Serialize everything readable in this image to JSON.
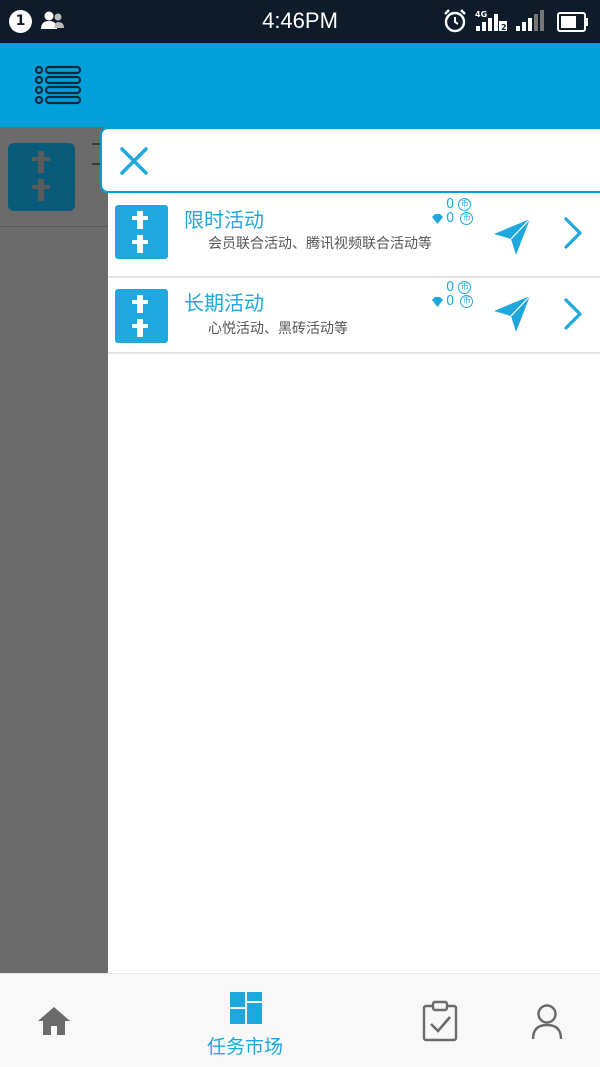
{
  "status_bar": {
    "notification_count": "1",
    "time": "4:46PM",
    "network": "4G",
    "sim": "2"
  },
  "drawer": {
    "items": [
      {
        "title": "限时活动",
        "description": "会员联合活动、腾讯视频联合活动等",
        "reward_top": "0",
        "reward_bottom": "0",
        "coin_glyph": "币"
      },
      {
        "title": "长期活动",
        "description": "心悦活动、黑砖活动等",
        "reward_top": "0",
        "reward_bottom": "0",
        "coin_glyph": "币"
      }
    ]
  },
  "bottom_nav": {
    "items": [
      {
        "icon": "home-icon"
      },
      {
        "icon": "grid-icon",
        "label": "任务市场",
        "active": true
      },
      {
        "icon": "clipboard-check-icon"
      },
      {
        "icon": "user-icon"
      }
    ]
  },
  "colors": {
    "accent": "#00a0da",
    "status_bar": "#0d1b2a",
    "overlay": "#6b6b6b"
  }
}
